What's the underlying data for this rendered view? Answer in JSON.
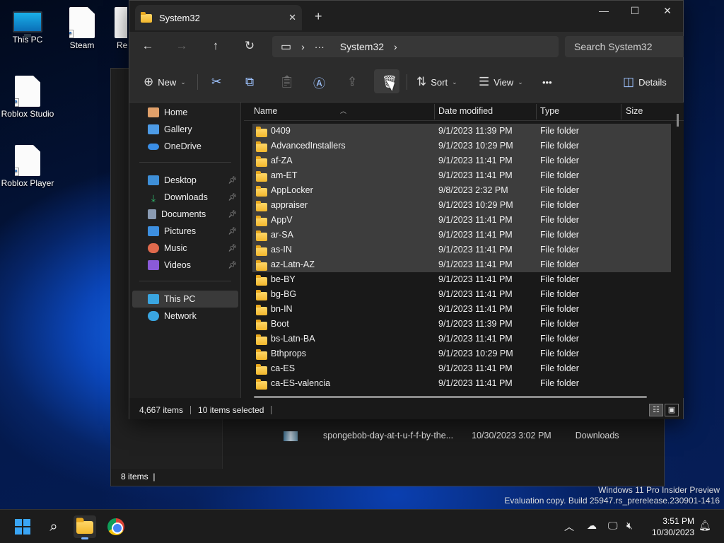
{
  "desktop": {
    "icons": [
      {
        "label": "This PC",
        "icon": "this-pc-icon"
      },
      {
        "label": "Steam",
        "icon": "shortcut-file-icon"
      },
      {
        "label": "Rec",
        "icon": "shortcut-file-icon"
      },
      {
        "label": "Roblox Studio",
        "icon": "shortcut-file-icon"
      },
      {
        "label": "Roblox Player",
        "icon": "shortcut-file-icon"
      }
    ]
  },
  "background_window": {
    "file_row": {
      "name": "spongebob-day-at-t-u-f-f-by-the...",
      "date": "10/30/2023 3:02 PM",
      "location": "Downloads"
    },
    "status": "8 items"
  },
  "explorer": {
    "tab_title": "System32",
    "new_tab_label": "+",
    "window_controls": {
      "minimize": "—",
      "maximize": "☐",
      "close": "✕"
    },
    "nav": {
      "back": "←",
      "forward": "→",
      "up": "↑",
      "refresh": "↻"
    },
    "address": {
      "device_icon": "▭",
      "sep1": "›",
      "ellipsis": "···",
      "current": "System32",
      "sep2": "›"
    },
    "search_placeholder": "Search System32",
    "toolbar": {
      "new_label": "New",
      "sort_label": "Sort",
      "view_label": "View",
      "more_label": "•••",
      "details_label": "Details"
    },
    "sidebar": [
      {
        "label": "Home",
        "color": "#e0a06a",
        "pinned": false
      },
      {
        "label": "Gallery",
        "color": "#4d9be6",
        "pinned": false
      },
      {
        "label": "OneDrive",
        "color": "#3a8ee6",
        "pinned": false
      },
      {
        "label": "Desktop",
        "color": "#3e8fd8",
        "pinned": true
      },
      {
        "label": "Downloads",
        "color": "#2fb36a",
        "pinned": true
      },
      {
        "label": "Documents",
        "color": "#8a9bb3",
        "pinned": true
      },
      {
        "label": "Pictures",
        "color": "#3d8fe0",
        "pinned": true
      },
      {
        "label": "Music",
        "color": "#e06a4d",
        "pinned": true
      },
      {
        "label": "Videos",
        "color": "#8a5ad8",
        "pinned": true
      },
      {
        "label": "This PC",
        "color": "#3aa5e0",
        "pinned": false
      },
      {
        "label": "Network",
        "color": "#3aa5e0",
        "pinned": false
      }
    ],
    "columns": {
      "name": "Name",
      "date": "Date modified",
      "type": "Type",
      "size": "Size"
    },
    "files": [
      {
        "name": "0409",
        "date": "9/1/2023 11:39 PM",
        "type": "File folder",
        "selected": true
      },
      {
        "name": "AdvancedInstallers",
        "date": "9/1/2023 10:29 PM",
        "type": "File folder",
        "selected": true
      },
      {
        "name": "af-ZA",
        "date": "9/1/2023 11:41 PM",
        "type": "File folder",
        "selected": true
      },
      {
        "name": "am-ET",
        "date": "9/1/2023 11:41 PM",
        "type": "File folder",
        "selected": true
      },
      {
        "name": "AppLocker",
        "date": "9/8/2023 2:32 PM",
        "type": "File folder",
        "selected": true
      },
      {
        "name": "appraiser",
        "date": "9/1/2023 10:29 PM",
        "type": "File folder",
        "selected": true
      },
      {
        "name": "AppV",
        "date": "9/1/2023 11:41 PM",
        "type": "File folder",
        "selected": true
      },
      {
        "name": "ar-SA",
        "date": "9/1/2023 11:41 PM",
        "type": "File folder",
        "selected": true
      },
      {
        "name": "as-IN",
        "date": "9/1/2023 11:41 PM",
        "type": "File folder",
        "selected": true
      },
      {
        "name": "az-Latn-AZ",
        "date": "9/1/2023 11:41 PM",
        "type": "File folder",
        "selected": true
      },
      {
        "name": "be-BY",
        "date": "9/1/2023 11:41 PM",
        "type": "File folder",
        "selected": false
      },
      {
        "name": "bg-BG",
        "date": "9/1/2023 11:41 PM",
        "type": "File folder",
        "selected": false
      },
      {
        "name": "bn-IN",
        "date": "9/1/2023 11:41 PM",
        "type": "File folder",
        "selected": false
      },
      {
        "name": "Boot",
        "date": "9/1/2023 11:39 PM",
        "type": "File folder",
        "selected": false
      },
      {
        "name": "bs-Latn-BA",
        "date": "9/1/2023 11:41 PM",
        "type": "File folder",
        "selected": false
      },
      {
        "name": "Bthprops",
        "date": "9/1/2023 10:29 PM",
        "type": "File folder",
        "selected": false
      },
      {
        "name": "ca-ES",
        "date": "9/1/2023 11:41 PM",
        "type": "File folder",
        "selected": false
      },
      {
        "name": "ca-ES-valencia",
        "date": "9/1/2023 11:41 PM",
        "type": "File folder",
        "selected": false
      }
    ],
    "status": {
      "items": "4,667 items",
      "selected": "10 items selected"
    }
  },
  "watermark": {
    "line1": "Windows 11 Pro Insider Preview",
    "line2": "Evaluation copy. Build 25947.rs_prerelease.230901-1416"
  },
  "taskbar": {
    "time": "3:51 PM",
    "date": "10/30/2023"
  }
}
